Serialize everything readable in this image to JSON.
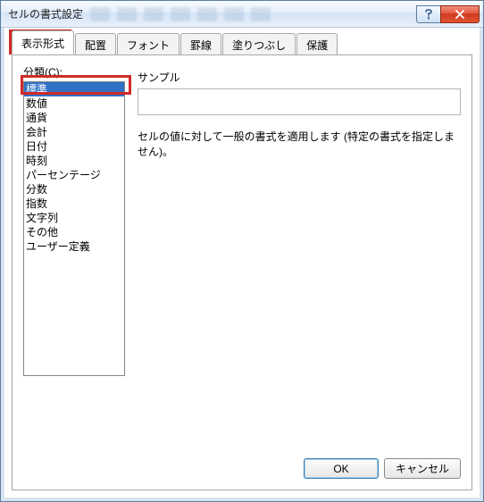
{
  "window": {
    "title": "セルの書式設定"
  },
  "tabs": [
    {
      "label": "表示形式",
      "active": true
    },
    {
      "label": "配置",
      "active": false
    },
    {
      "label": "フォント",
      "active": false
    },
    {
      "label": "罫線",
      "active": false
    },
    {
      "label": "塗りつぶし",
      "active": false
    },
    {
      "label": "保護",
      "active": false
    }
  ],
  "category_label": "分類(C):",
  "categories": [
    {
      "label": "標準",
      "selected": true
    },
    {
      "label": "数値",
      "selected": false
    },
    {
      "label": "通貨",
      "selected": false
    },
    {
      "label": "会計",
      "selected": false
    },
    {
      "label": "日付",
      "selected": false
    },
    {
      "label": "時刻",
      "selected": false
    },
    {
      "label": "パーセンテージ",
      "selected": false
    },
    {
      "label": "分数",
      "selected": false
    },
    {
      "label": "指数",
      "selected": false
    },
    {
      "label": "文字列",
      "selected": false
    },
    {
      "label": "その他",
      "selected": false
    },
    {
      "label": "ユーザー定義",
      "selected": false
    }
  ],
  "sample_label": "サンプル",
  "description": "セルの値に対して一般の書式を適用します (特定の書式を指定しません)。",
  "buttons": {
    "ok": "OK",
    "cancel": "キャンセル"
  }
}
